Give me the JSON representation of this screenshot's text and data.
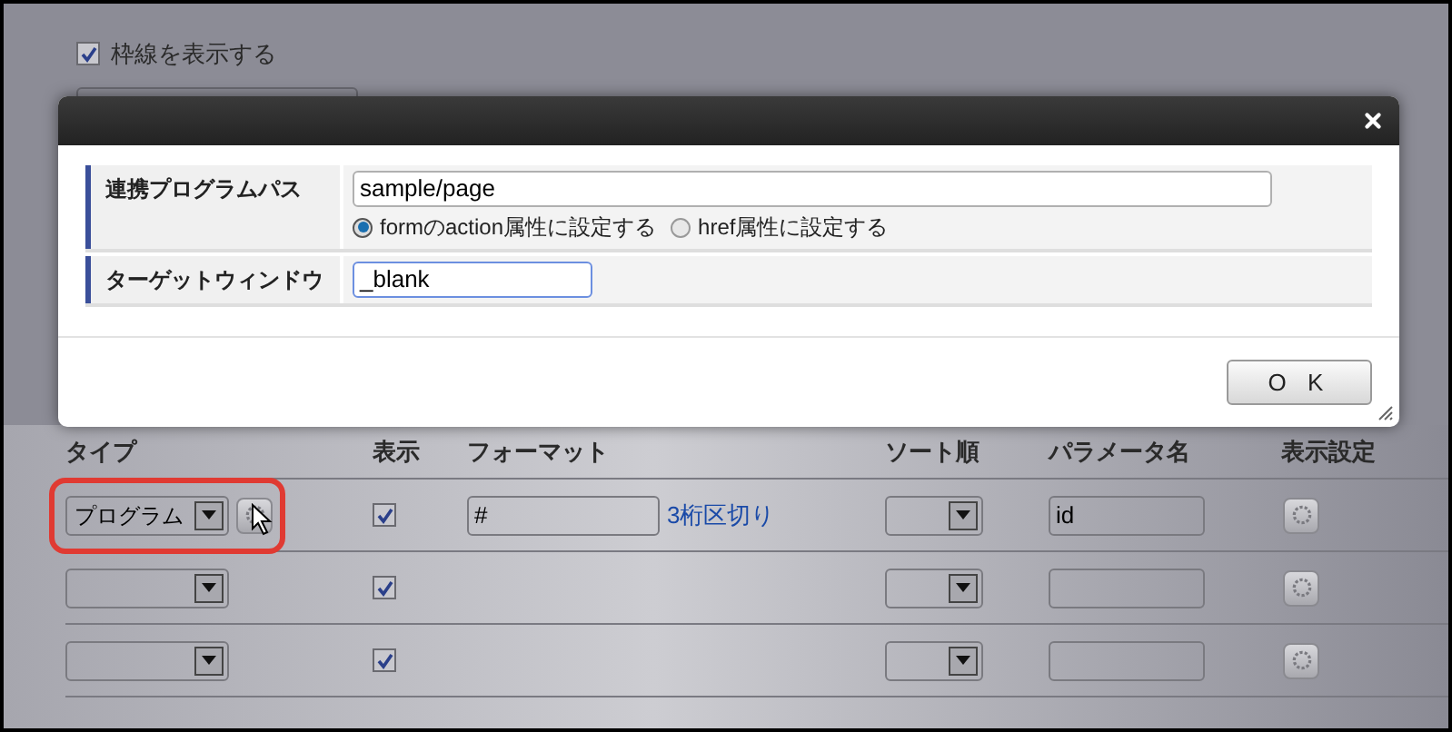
{
  "page": {
    "border_option": {
      "label": "枠線を表示する",
      "checked": true
    },
    "table": {
      "columns": [
        "タイプ",
        "表示",
        "フォーマット",
        "ソート順",
        "パラメータ名",
        "表示設定"
      ],
      "rows": [
        {
          "type": "プログラム",
          "type_settings_button": true,
          "highlighted": true,
          "visible": true,
          "format": "#",
          "format_link": "3桁区切り",
          "parameter": "id"
        },
        {
          "type_settings_button": false,
          "highlighted": false,
          "visible": true
        },
        {
          "type_settings_button": false,
          "highlighted": false,
          "visible": true
        }
      ]
    }
  },
  "dialog": {
    "fields": [
      {
        "label": "連携プログラムパス",
        "value": "sample/page",
        "focused": false,
        "radios": [
          {
            "label": "formのaction属性に設定する",
            "selected": true
          },
          {
            "label": "href属性に設定する",
            "selected": false
          }
        ]
      },
      {
        "label": "ターゲットウィンドウ",
        "value": "_blank",
        "focused": true
      }
    ],
    "ok_button": "O K"
  }
}
